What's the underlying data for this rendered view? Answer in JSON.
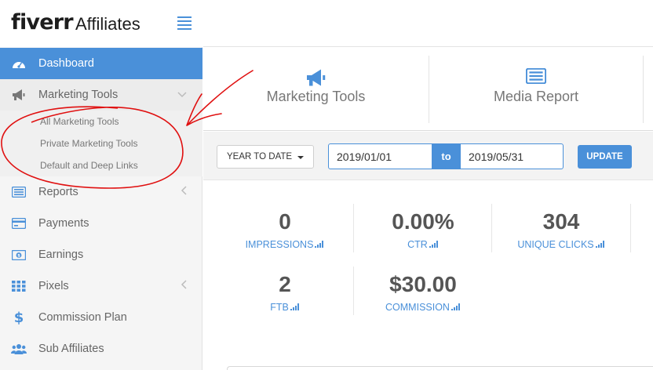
{
  "brand": {
    "logo": "fiverr",
    "product": "Affiliates"
  },
  "sidebar": {
    "items": [
      {
        "label": "Dashboard",
        "icon": "dashboard-icon"
      },
      {
        "label": "Marketing Tools",
        "icon": "megaphone-icon"
      },
      {
        "label": "Reports",
        "icon": "list-icon"
      },
      {
        "label": "Payments",
        "icon": "credit-card-icon"
      },
      {
        "label": "Earnings",
        "icon": "money-icon"
      },
      {
        "label": "Pixels",
        "icon": "grid-icon"
      },
      {
        "label": "Commission Plan",
        "icon": "dollar-icon"
      },
      {
        "label": "Sub Affiliates",
        "icon": "users-icon"
      }
    ],
    "submenu": [
      "All Marketing Tools",
      "Private Marketing Tools",
      "Default and Deep Links"
    ]
  },
  "tabs": [
    {
      "label": "Marketing Tools",
      "icon": "megaphone-icon"
    },
    {
      "label": "Media Report",
      "icon": "list-icon"
    }
  ],
  "filters": {
    "range": "YEAR TO DATE",
    "start_date": "2019/01/01",
    "to_label": "to",
    "end_date": "2019/05/31",
    "update_label": "UPDATE"
  },
  "stats": [
    {
      "value": "0",
      "label": "IMPRESSIONS"
    },
    {
      "value": "0.00%",
      "label": "CTR"
    },
    {
      "value": "304",
      "label": "UNIQUE CLICKS"
    },
    {
      "value": "2",
      "label": "FTB"
    },
    {
      "value": "$30.00",
      "label": "COMMISSION"
    }
  ],
  "colors": {
    "accent": "#4a90d9",
    "annotation": "#e01010",
    "sidebar_bg": "#f5f5f5"
  }
}
